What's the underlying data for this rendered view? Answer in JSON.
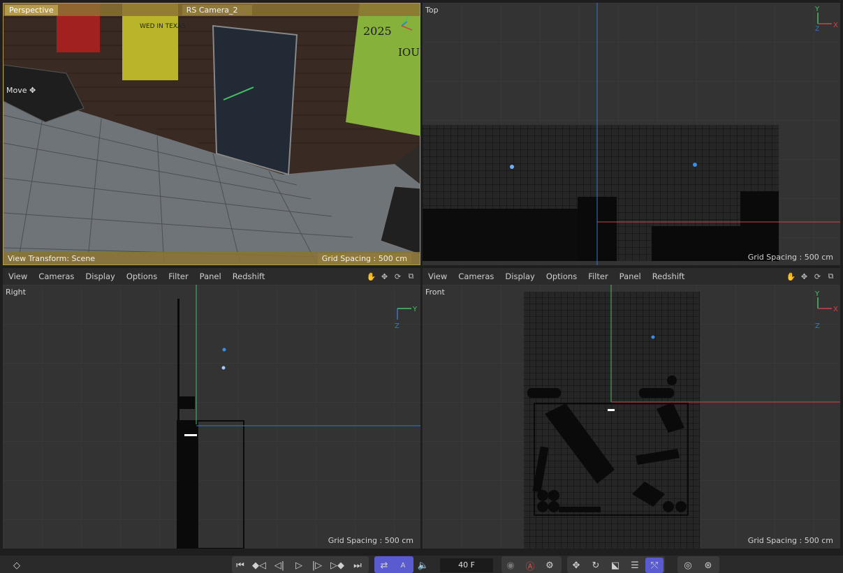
{
  "viewports": {
    "perspective": {
      "label": "Perspective",
      "camera": "RS Camera_2",
      "tool": "Move",
      "view_transform": "View Transform: Scene",
      "grid_spacing": "Grid Spacing : 500 cm",
      "posters": [
        "2025",
        "IOU",
        "WED IN TEXAS"
      ]
    },
    "top": {
      "label": "Top",
      "grid_spacing": "Grid Spacing : 500 cm",
      "axes": [
        "Y",
        "X",
        "Z"
      ]
    },
    "right": {
      "label": "Right",
      "grid_spacing": "Grid Spacing : 500 cm",
      "axes": [
        "Y",
        "Z"
      ]
    },
    "front": {
      "label": "Front",
      "grid_spacing": "Grid Spacing : 500 cm",
      "axes": [
        "Y",
        "X",
        "Z"
      ]
    }
  },
  "menu": {
    "items": [
      "View",
      "Cameras",
      "Display",
      "Options",
      "Filter",
      "Panel",
      "Redshift"
    ]
  },
  "timeline": {
    "frame": "40 F",
    "record_label": "A"
  },
  "colors": {
    "viewport_bg": "#333333",
    "grid_line": "#3c3c3c",
    "axis_x": "#c84848",
    "axis_y": "#4dbb6a",
    "axis_z": "#3a74d0",
    "active_button": "#5b5bd0",
    "perspective_bar": "#8c7332"
  },
  "icons": [
    "hand-pan-icon",
    "move-arrows-icon",
    "rotate-icon",
    "maximize-icon"
  ]
}
